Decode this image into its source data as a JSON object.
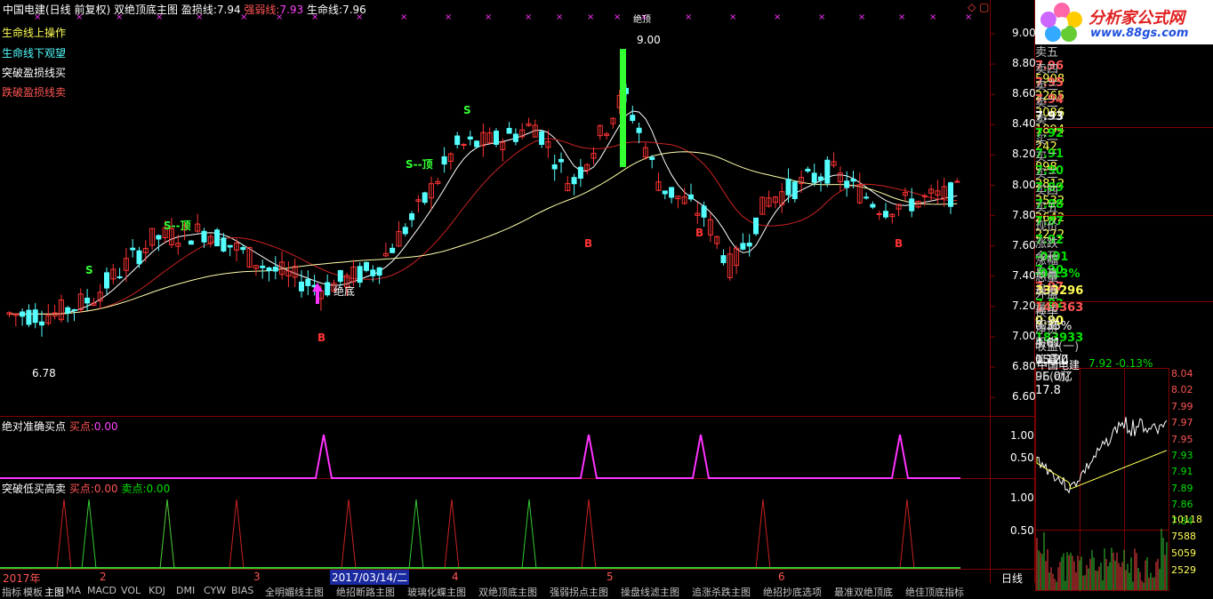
{
  "header": {
    "title": "中国电建(日线 前复权) 双绝顶底主图",
    "stop_loss_label": "盈损线:",
    "stop_loss_value": "7.94",
    "strength_label": "强弱线:",
    "strength_value": "7.93",
    "life_label": "生命线:",
    "life_value": "7.96"
  },
  "legend": [
    "生命线上操作",
    "生命线下观望",
    "突破盈损线买",
    "跌破盈损线卖"
  ],
  "price_axis": [
    "9.00",
    "8.80",
    "8.60",
    "8.40",
    "8.20",
    "8.00",
    "7.80",
    "7.60",
    "7.40",
    "7.20",
    "7.00",
    "6.80",
    "6.60"
  ],
  "annotations": {
    "high_label": "9.00",
    "low_label": "6.78",
    "jue_ding": "绝顶",
    "jue_di": "绝底",
    "s1": "S",
    "s2": "S--顶",
    "s3": "S--顶",
    "s4": "S",
    "b": "B"
  },
  "ind1": {
    "title": "绝对准确买点",
    "buy_label": "买点:",
    "buy_value": "0.00",
    "axis": [
      "1.00",
      "0.50"
    ]
  },
  "ind2": {
    "title": "突破低买高卖",
    "buy_label": "买点:",
    "buy_value": "0.00",
    "sell_label": "卖点:",
    "sell_value": "0.00",
    "axis": [
      "1.00",
      "0.50"
    ]
  },
  "time_axis": {
    "year": "2017年",
    "m2": "2",
    "m3": "3",
    "cursor_date": "2017/03/14/二",
    "m4": "4",
    "m5": "5",
    "m6": "6",
    "period": "日线"
  },
  "logo": {
    "name": "分析家公式网",
    "url": "www.88gs.com"
  },
  "order_book": {
    "sell": [
      {
        "label": "卖五",
        "price": "7.96",
        "vol": "5908",
        "color": "#ff5555"
      },
      {
        "label": "卖四",
        "price": "7.95",
        "vol": "2265",
        "color": "#ff5555"
      },
      {
        "label": "卖三",
        "price": "7.94",
        "vol": "3086",
        "color": "#ff5555"
      },
      {
        "label": "卖二",
        "price": "7.93",
        "vol": "1894",
        "color": "#ffffff"
      },
      {
        "label": "卖一",
        "price": "7.92",
        "vol": "242",
        "color": "#00e000"
      }
    ],
    "buy": [
      {
        "label": "买一",
        "price": "7.91",
        "vol": "898",
        "color": "#00e000"
      },
      {
        "label": "买二",
        "price": "7.90",
        "vol": "2812",
        "color": "#00e000"
      },
      {
        "label": "买三",
        "price": "7.89",
        "vol": "3532",
        "color": "#00e000"
      },
      {
        "label": "买四",
        "price": "7.88",
        "vol": "2642",
        "color": "#00e000"
      },
      {
        "label": "买五",
        "price": "7.87",
        "vol": "2272",
        "color": "#00e000"
      }
    ]
  },
  "quote": [
    {
      "l1": "现价",
      "v1": "7.92",
      "c1": "#00e000",
      "l2": "今开",
      "v2": "7.90",
      "c2": "#00e000"
    },
    {
      "l1": "涨跌",
      "v1": "-0.01",
      "c1": "#00e000",
      "l2": "最高",
      "v2": "7.97",
      "c2": "#ff5555"
    },
    {
      "l1": "涨幅",
      "v1": "-0.13%",
      "c1": "#00e000",
      "l2": "最低",
      "v2": "7.82",
      "c2": "#00e000"
    },
    {
      "l1": "总量",
      "v1": "333296",
      "c1": "#ffff55",
      "l2": "量比",
      "v2": "0.90",
      "c2": "#ffff55"
    },
    {
      "l1": "外盘",
      "v1": "149363",
      "c1": "#ff5555",
      "l2": "内盘",
      "v2": "183933",
      "c2": "#00e000"
    }
  ],
  "quote2": [
    {
      "l1": "换手",
      "v1": "0.35%",
      "l2": "股本",
      "v2": "153亿"
    },
    {
      "l1": "净资",
      "v1": "4.61",
      "l2": "流通",
      "v2": "96.0亿"
    },
    {
      "l1": "收益(一)",
      "v1": "0.120",
      "l2": "PE(动)",
      "v2": "17.8"
    }
  ],
  "mini_chart": {
    "name": "中国电建",
    "price": "7.92",
    "change": "-0.13%",
    "axis": [
      "8.04",
      "8.02",
      "7.99",
      "7.97",
      "7.95",
      "7.93",
      "7.91",
      "7.89",
      "7.86",
      "7.84"
    ],
    "vol_axis": [
      "10118",
      "7588",
      "5059",
      "2529"
    ]
  },
  "tabs": [
    "指标",
    "模板",
    "主图",
    "MA",
    "MACD",
    "VOL",
    "KDJ",
    "DMI",
    "CYW",
    "BIAS",
    "全明媚线主图",
    "绝招断路主图",
    "玻璃化蝶主图",
    "双绝顶底主图",
    "强弱拐点主图",
    "操盘线滤主图",
    "追涨杀跌主图",
    "绝招抄底选项",
    "最准双绝顶底",
    "绝佳顶底指标"
  ],
  "colors": {
    "up": "#ff3333",
    "down": "#55ffff",
    "magenta": "#ff33ff",
    "frame": "#800000"
  }
}
